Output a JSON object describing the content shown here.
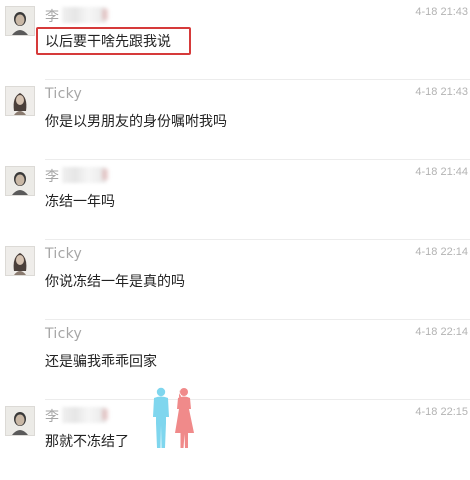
{
  "messages": [
    {
      "sender": "李",
      "time": "4-18 21:43",
      "text": "以后要干啥先跟我说",
      "avatar": "male-avatar"
    },
    {
      "sender": "Ticky",
      "time": "4-18 21:43",
      "text": "你是以男朋友的身份嘱咐我吗",
      "avatar": "female-avatar"
    },
    {
      "sender": "李",
      "time": "4-18 21:44",
      "text": "冻结一年吗",
      "avatar": "male-avatar"
    },
    {
      "sender": "Ticky",
      "time": "4-18 22:14",
      "text": "你说冻结一年是真的吗",
      "avatar": "female-avatar"
    },
    {
      "sender": "Ticky",
      "time": "4-18 22:14",
      "text": "还是骗我乖乖回家",
      "avatar": "none"
    },
    {
      "sender": "李",
      "time": "4-18 22:15",
      "text": "那就不冻结了",
      "avatar": "male-avatar"
    }
  ],
  "colors": {
    "highlight": "#d63a3a",
    "man_figure": "#7fd6ee",
    "woman_figure": "#f08a8a"
  }
}
